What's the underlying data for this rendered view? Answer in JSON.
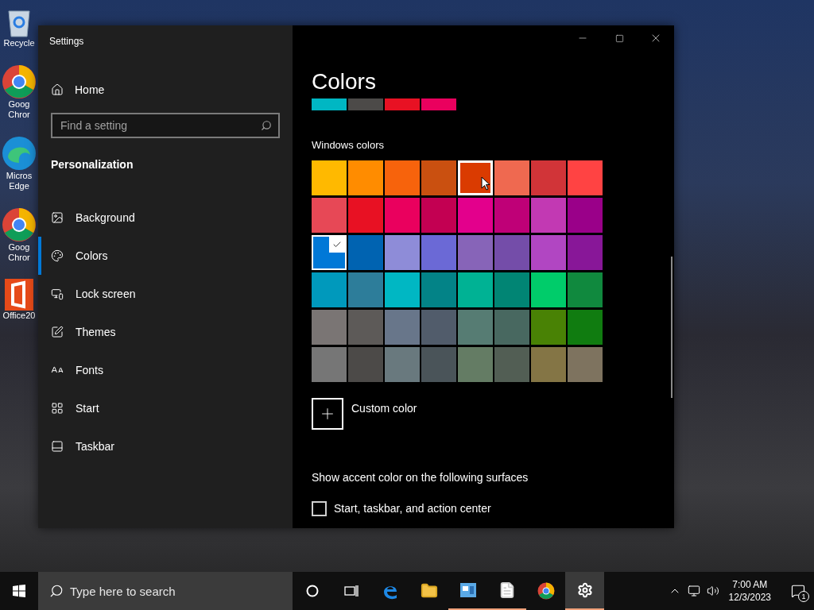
{
  "desktop_icons": [
    {
      "kind": "recycle",
      "label": "Recycle"
    },
    {
      "kind": "chrome",
      "label": "Goog Chror"
    },
    {
      "kind": "edge",
      "label": "Micros Edge"
    },
    {
      "kind": "chrome",
      "label": "Goog Chror"
    },
    {
      "kind": "office",
      "label": "Office20"
    }
  ],
  "window": {
    "title": "Settings"
  },
  "sidebar": {
    "home": "Home",
    "search": {
      "placeholder": "Find a setting"
    },
    "section": "Personalization",
    "items": [
      {
        "kind": "picture",
        "label": "Background",
        "selected": false
      },
      {
        "kind": "palette",
        "label": "Colors",
        "selected": true
      },
      {
        "kind": "lock",
        "label": "Lock screen",
        "selected": false
      },
      {
        "kind": "pen",
        "label": "Themes",
        "selected": false
      },
      {
        "kind": "fonts",
        "label": "Fonts",
        "selected": false
      },
      {
        "kind": "grid",
        "label": "Start",
        "selected": false
      },
      {
        "kind": "bar",
        "label": "Taskbar",
        "selected": false
      }
    ]
  },
  "content": {
    "title": "Colors",
    "recent_colors": [
      {
        "color": "#00b7c3"
      },
      {
        "color": "#4c4a48"
      },
      {
        "color": "#e81123"
      },
      {
        "color": "#ea005e"
      }
    ],
    "windows_colors_label": "Windows colors",
    "windows_colors": [
      [
        {
          "color": "#ffb900",
          "selected": false,
          "hovered": false
        },
        {
          "color": "#ff8c00",
          "selected": false,
          "hovered": false
        },
        {
          "color": "#f7630c",
          "selected": false,
          "hovered": false
        },
        {
          "color": "#ca5010",
          "selected": false,
          "hovered": false
        },
        {
          "color": "#da3b01",
          "selected": false,
          "hovered": true
        },
        {
          "color": "#ef6950",
          "selected": false,
          "hovered": false
        },
        {
          "color": "#d13438",
          "selected": false,
          "hovered": false
        },
        {
          "color": "#ff4343",
          "selected": false,
          "hovered": false
        }
      ],
      [
        {
          "color": "#e74856",
          "selected": false,
          "hovered": false
        },
        {
          "color": "#e81123",
          "selected": false,
          "hovered": false
        },
        {
          "color": "#ea005e",
          "selected": false,
          "hovered": false
        },
        {
          "color": "#c30052",
          "selected": false,
          "hovered": false
        },
        {
          "color": "#e3008c",
          "selected": false,
          "hovered": false
        },
        {
          "color": "#bf0077",
          "selected": false,
          "hovered": false
        },
        {
          "color": "#c239b3",
          "selected": false,
          "hovered": false
        },
        {
          "color": "#9a0089",
          "selected": false,
          "hovered": false
        }
      ],
      [
        {
          "color": "#0078d7",
          "selected": true,
          "hovered": false
        },
        {
          "color": "#0063b1",
          "selected": false,
          "hovered": false
        },
        {
          "color": "#8e8cd8",
          "selected": false,
          "hovered": false
        },
        {
          "color": "#6b69d6",
          "selected": false,
          "hovered": false
        },
        {
          "color": "#8764b8",
          "selected": false,
          "hovered": false
        },
        {
          "color": "#744da9",
          "selected": false,
          "hovered": false
        },
        {
          "color": "#b146c2",
          "selected": false,
          "hovered": false
        },
        {
          "color": "#881798",
          "selected": false,
          "hovered": false
        }
      ],
      [
        {
          "color": "#0099bc",
          "selected": false,
          "hovered": false
        },
        {
          "color": "#2d7d9a",
          "selected": false,
          "hovered": false
        },
        {
          "color": "#00b7c3",
          "selected": false,
          "hovered": false
        },
        {
          "color": "#038387",
          "selected": false,
          "hovered": false
        },
        {
          "color": "#00b294",
          "selected": false,
          "hovered": false
        },
        {
          "color": "#018574",
          "selected": false,
          "hovered": false
        },
        {
          "color": "#00cc6a",
          "selected": false,
          "hovered": false
        },
        {
          "color": "#10893e",
          "selected": false,
          "hovered": false
        }
      ],
      [
        {
          "color": "#7a7574",
          "selected": false,
          "hovered": false
        },
        {
          "color": "#5d5a58",
          "selected": false,
          "hovered": false
        },
        {
          "color": "#68768a",
          "selected": false,
          "hovered": false
        },
        {
          "color": "#515c6b",
          "selected": false,
          "hovered": false
        },
        {
          "color": "#567c73",
          "selected": false,
          "hovered": false
        },
        {
          "color": "#486860",
          "selected": false,
          "hovered": false
        },
        {
          "color": "#498205",
          "selected": false,
          "hovered": false
        },
        {
          "color": "#107c10",
          "selected": false,
          "hovered": false
        }
      ],
      [
        {
          "color": "#767676",
          "selected": false,
          "hovered": false
        },
        {
          "color": "#4c4a48",
          "selected": false,
          "hovered": false
        },
        {
          "color": "#69797e",
          "selected": false,
          "hovered": false
        },
        {
          "color": "#4a5459",
          "selected": false,
          "hovered": false
        },
        {
          "color": "#647c64",
          "selected": false,
          "hovered": false
        },
        {
          "color": "#525e54",
          "selected": false,
          "hovered": false
        },
        {
          "color": "#847545",
          "selected": false,
          "hovered": false
        },
        {
          "color": "#7e735f",
          "selected": false,
          "hovered": false
        }
      ]
    ],
    "custom_color": "Custom color",
    "surfaces_label": "Show accent color on the following surfaces",
    "surfaces": [
      {
        "label": "Start, taskbar, and action center",
        "checked": false
      }
    ]
  },
  "taskbar": {
    "search": {
      "placeholder": "Type here to search"
    },
    "apps": [
      {
        "kind": "cortana",
        "running": false,
        "active": false
      },
      {
        "kind": "taskview",
        "running": false,
        "active": false
      },
      {
        "kind": "edge",
        "running": false,
        "active": false
      },
      {
        "kind": "folder",
        "running": false,
        "active": false
      },
      {
        "kind": "app",
        "running": true,
        "active": false
      },
      {
        "kind": "notepad",
        "running": true,
        "active": false
      },
      {
        "kind": "chrome",
        "running": false,
        "active": false
      },
      {
        "kind": "gear",
        "running": true,
        "active": true
      }
    ],
    "time": "7:00 AM",
    "date": "12/3/2023",
    "notifications": "1"
  }
}
